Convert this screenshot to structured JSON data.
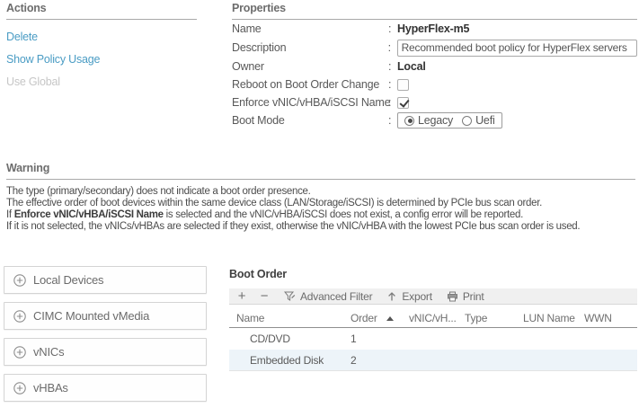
{
  "ui": {
    "colon": ":"
  },
  "colors": {
    "link_blue": "#4a9cc4",
    "disabled_link": "#c6c6c6",
    "section_header_gray": "#6d6d6d",
    "toolbar_bg": "#f0f0f0",
    "alt_row_bg": "#edf4f9"
  },
  "icons": {
    "add": "+",
    "remove": "−",
    "expand": "plus-circle",
    "advanced_filter": "funnel-pencil",
    "export": "arrow-up",
    "print": "printer",
    "sort_asc": "triangle-up"
  },
  "actions": {
    "title": "Actions",
    "items": [
      {
        "label": "Delete",
        "enabled": true
      },
      {
        "label": "Show Policy Usage",
        "enabled": true
      },
      {
        "label": "Use Global",
        "enabled": false
      }
    ]
  },
  "properties": {
    "title": "Properties",
    "name_label": "Name",
    "name_value": "HyperFlex-m5",
    "description_label": "Description",
    "description_value": "Recommended boot policy for HyperFlex servers",
    "owner_label": "Owner",
    "owner_value": "Local",
    "reboot_label": "Reboot on Boot Order Change",
    "reboot_checked": false,
    "enforce_label": "Enforce vNIC/vHBA/iSCSI Name",
    "enforce_checked": true,
    "boot_mode_label": "Boot Mode",
    "boot_mode_options": [
      "Legacy",
      "Uefi"
    ],
    "boot_mode_selected": "Legacy"
  },
  "warning": {
    "title": "Warning",
    "line1": "The type (primary/secondary) does not indicate a boot order presence.",
    "line2": "The effective order of boot devices within the same device class (LAN/Storage/iSCSI) is determined by PCIe bus scan order.",
    "line3_prefix": "If ",
    "line3_bold": "Enforce vNIC/vHBA/iSCSI Name",
    "line3_suffix": " is selected and the vNIC/vHBA/iSCSI does not exist, a config error will be reported.",
    "line4": "If it is not selected, the vNICs/vHBAs are selected if they exist, otherwise the vNIC/vHBA with the lowest PCIe bus scan order is used."
  },
  "device_panels": [
    {
      "label": "Local Devices"
    },
    {
      "label": "CIMC Mounted vMedia"
    },
    {
      "label": "vNICs"
    },
    {
      "label": "vHBAs"
    }
  ],
  "boot_order": {
    "title": "Boot Order",
    "toolbar": {
      "advanced_filter": "Advanced Filter",
      "export": "Export",
      "print": "Print"
    },
    "columns": [
      "Name",
      "Order",
      "vNIC/vH...",
      "Type",
      "LUN Name",
      "WWN"
    ],
    "sort": {
      "column": "Order",
      "direction": "asc"
    },
    "rows": [
      {
        "name": "CD/DVD",
        "order": "1",
        "vnic": "",
        "type": "",
        "lun_name": "",
        "wwn": ""
      },
      {
        "name": "Embedded Disk",
        "order": "2",
        "vnic": "",
        "type": "",
        "lun_name": "",
        "wwn": ""
      }
    ]
  }
}
